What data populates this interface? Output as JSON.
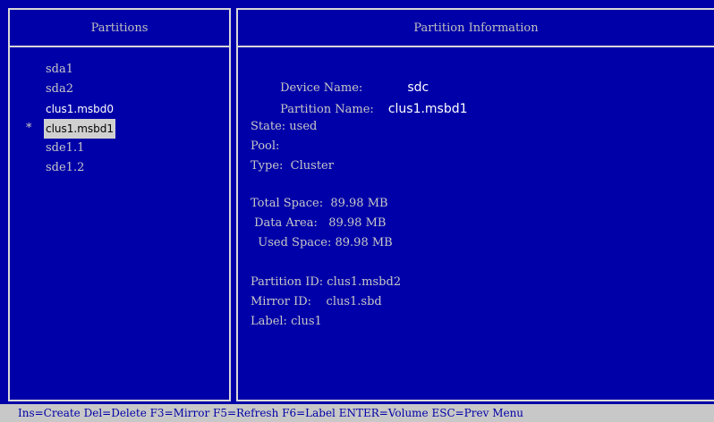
{
  "left_panel": {
    "title": "Partitions",
    "items": [
      {
        "label": "sda1",
        "marker": ""
      },
      {
        "label": "sda2",
        "marker": ""
      },
      {
        "label": "clus1.msbd0",
        "marker": ""
      },
      {
        "label": "clus1.msbd1",
        "marker": "*"
      },
      {
        "label": "sde1.1",
        "marker": ""
      },
      {
        "label": "sde1.2",
        "marker": ""
      }
    ]
  },
  "right_panel": {
    "title": "Partition Information",
    "device_name_label": "Device Name:",
    "device_name_value": "sdc",
    "partition_name_label": "Partition Name:",
    "partition_name_value": "clus1.msbd1",
    "state": "State: used",
    "pool": "Pool:",
    "type": "Type:  Cluster",
    "total_space": "Total Space:  89.98 MB",
    "data_area": " Data Area:   89.98 MB",
    "used_space": "  Used Space: 89.98 MB",
    "partition_id": "Partition ID: clus1.msbd2",
    "mirror_id": "Mirror ID:    clus1.sbd",
    "label": "Label: clus1"
  },
  "status_bar": {
    "text": "Ins=Create Del=Delete F3=Mirror F5=Refresh F6=Label ENTER=Volume ESC=Prev Menu"
  }
}
